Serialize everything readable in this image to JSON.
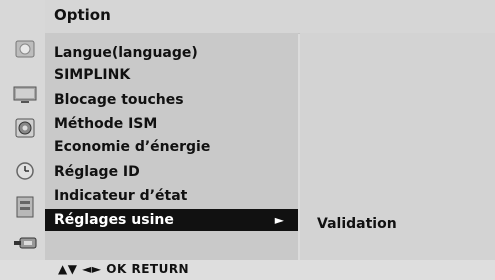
{
  "title": "Option",
  "menu_items": [
    {
      "label": "Langue(language)"
    },
    {
      "label": "SIMPLINK"
    },
    {
      "label": "Blocage touches"
    },
    {
      "label": "Méthode ISM"
    },
    {
      "label": "Economie d’énergie"
    },
    {
      "label": "Réglage ID"
    },
    {
      "label": "Indicateur d’état"
    },
    {
      "label": "Réglages usine",
      "selected": true,
      "arrow": "►"
    }
  ],
  "submenu_item": "Validation",
  "footer_hint": "▲▼  ◄►  OK  RETURN",
  "side_icons": [
    "picture-icon",
    "screen-icon",
    "audio-icon",
    "time-icon",
    "option-icon",
    "input-icon"
  ]
}
